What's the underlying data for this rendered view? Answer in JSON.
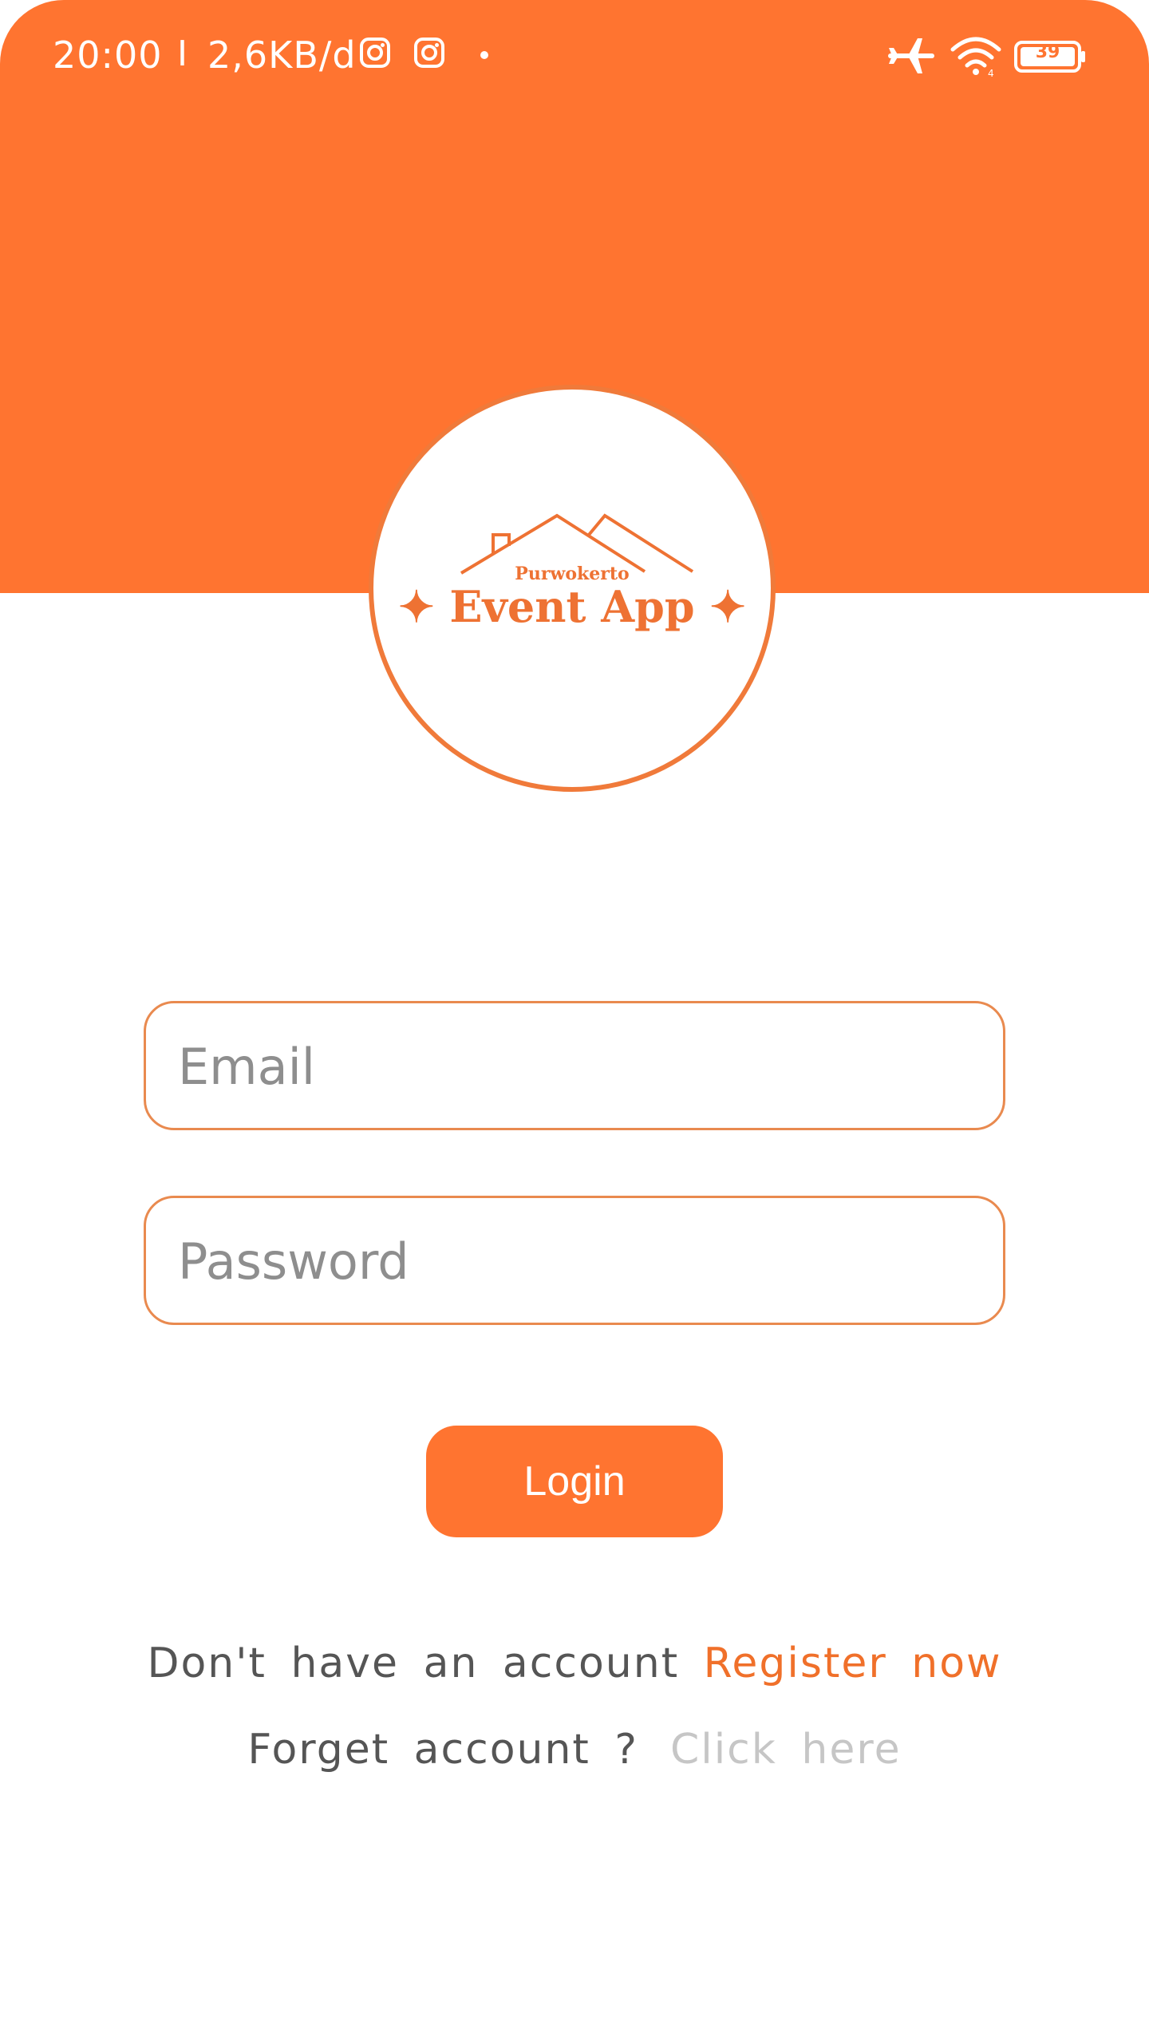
{
  "status_bar": {
    "time": "20:00",
    "separator": "I",
    "speed": "2,6KB/d",
    "battery": "39",
    "icons": [
      "instagram-icon",
      "instagram-icon",
      "airplane-icon",
      "wifi-icon",
      "battery-icon"
    ]
  },
  "logo": {
    "small_text": "Purwokerto",
    "main_text": "✦ Event App ✦"
  },
  "form": {
    "email_placeholder": "Email",
    "password_placeholder": "Password",
    "login_label": "Login"
  },
  "links": {
    "no_account_text": "Don't have an account",
    "register_label": "Register now",
    "forget_text": "Forget account ?",
    "click_here_label": "Click here"
  },
  "colors": {
    "accent": "#FF7430",
    "link_muted": "#C6C6C6",
    "text": "#555555"
  }
}
